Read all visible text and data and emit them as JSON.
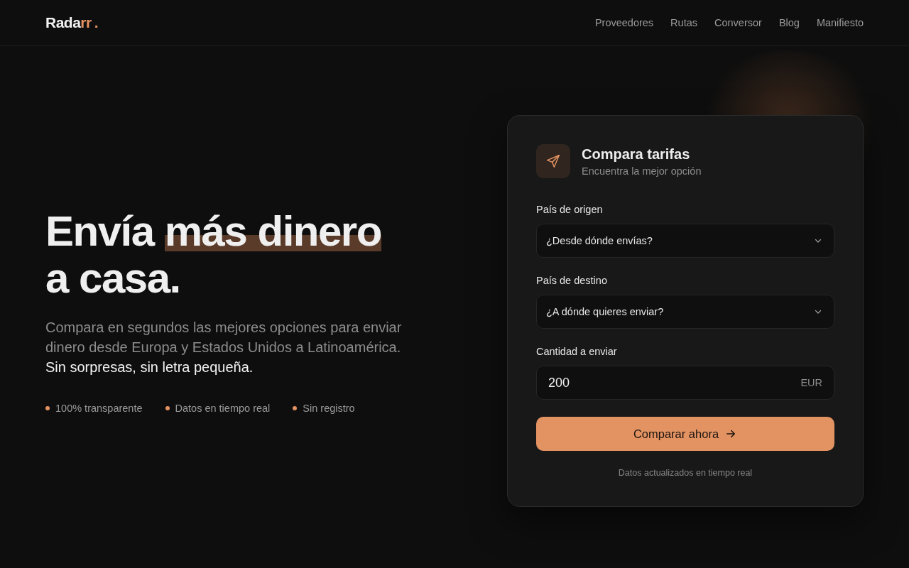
{
  "logo": {
    "main": "Rada",
    "accent": "rr",
    "dot": "."
  },
  "nav": [
    {
      "label": "Proveedores"
    },
    {
      "label": "Rutas"
    },
    {
      "label": "Conversor"
    },
    {
      "label": "Blog"
    },
    {
      "label": "Manifiesto"
    }
  ],
  "hero": {
    "title_start": "Envía",
    "title_highlight": "más dinero",
    "title_end": "a casa.",
    "intro": "Compara en segundos las mejores opciones para enviar dinero desde Europa y Estados Unidos a Latinoamérica.",
    "intro_emphasis": "Sin sorpresas, sin letra pequeña.",
    "features": [
      "100% transparente",
      "Datos en tiempo real",
      "Sin registro"
    ]
  },
  "card": {
    "title": "Compara tarifas",
    "subtitle": "Encuentra la mejor opción",
    "fields": [
      {
        "kind": "select",
        "label": "País de origen",
        "placeholder": "¿Desde dónde envías?"
      },
      {
        "kind": "select",
        "label": "País de destino",
        "placeholder": "¿A dónde quieres enviar?"
      },
      {
        "kind": "amount",
        "label": "Cantidad a enviar",
        "value": "200",
        "unit": "EUR"
      }
    ],
    "button": "Comparar ahora",
    "note": "Datos actualizados en tiempo real"
  }
}
